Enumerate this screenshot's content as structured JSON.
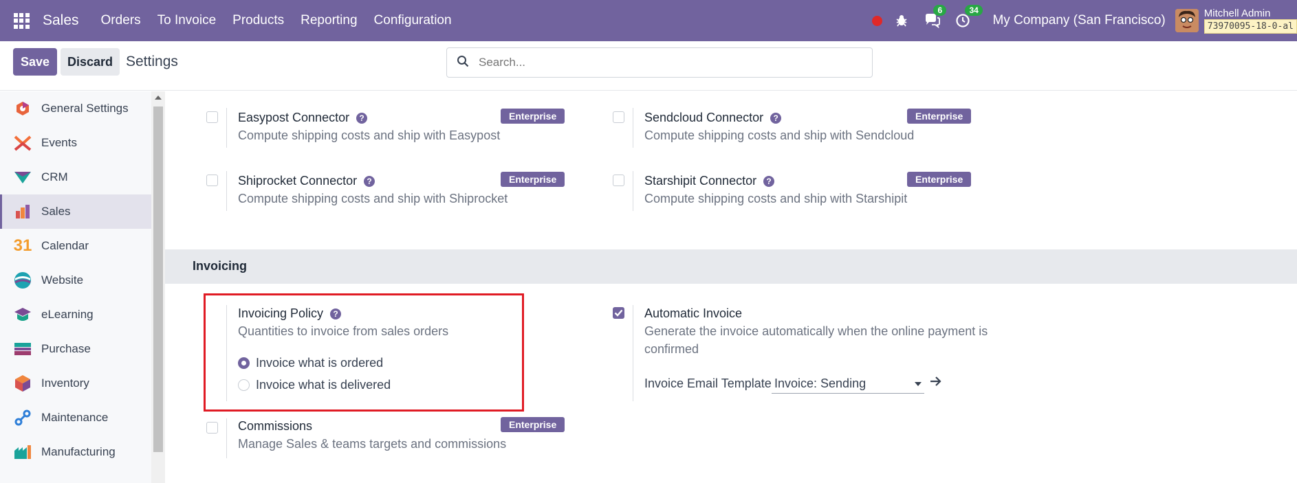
{
  "navbar": {
    "brand": "Sales",
    "menu": [
      "Orders",
      "To Invoice",
      "Products",
      "Reporting",
      "Configuration"
    ],
    "messages_count": "6",
    "activities_count": "34",
    "company": "My Company (San Francisco)",
    "user": "Mitchell Admin",
    "database": "73970095-18-0-al"
  },
  "control": {
    "save_label": "Save",
    "discard_label": "Discard",
    "title": "Settings",
    "search_placeholder": "Search..."
  },
  "sidebar": {
    "items": [
      {
        "label": "General Settings",
        "icon": "general-settings-icon",
        "color": "#e8643c"
      },
      {
        "label": "Events",
        "icon": "events-icon",
        "color": "#f36f3a"
      },
      {
        "label": "CRM",
        "icon": "crm-icon",
        "color": "#1aa39a"
      },
      {
        "label": "Sales",
        "icon": "sales-icon",
        "color": "#f0863e",
        "active": true
      },
      {
        "label": "Calendar",
        "icon": "calendar-icon",
        "color": "#f39c2d"
      },
      {
        "label": "Website",
        "icon": "website-icon",
        "color": "#1ea3b1"
      },
      {
        "label": "eLearning",
        "icon": "elearning-icon",
        "color": "#1aa38a"
      },
      {
        "label": "Purchase",
        "icon": "purchase-icon",
        "color": "#1aa39a"
      },
      {
        "label": "Inventory",
        "icon": "inventory-icon",
        "color": "#f0863e"
      },
      {
        "label": "Maintenance",
        "icon": "maintenance-icon",
        "color": "#2f7fd8"
      },
      {
        "label": "Manufacturing",
        "icon": "manufacturing-icon",
        "color": "#1aa39a"
      }
    ]
  },
  "enterprise_label": "Enterprise",
  "shipping": {
    "easypost": {
      "title": "Easypost Connector",
      "desc": "Compute shipping costs and ship with Easypost"
    },
    "sendcloud": {
      "title": "Sendcloud Connector",
      "desc": "Compute shipping costs and ship with Sendcloud"
    },
    "shiprocket": {
      "title": "Shiprocket Connector",
      "desc": "Compute shipping costs and ship with Shiprocket"
    },
    "starshipit": {
      "title": "Starshipit Connector",
      "desc": "Compute shipping costs and ship with Starshipit"
    }
  },
  "invoicing": {
    "section_title": "Invoicing",
    "policy": {
      "title": "Invoicing Policy",
      "desc": "Quantities to invoice from sales orders",
      "options": [
        "Invoice what is ordered",
        "Invoice what is delivered"
      ],
      "selected": "Invoice what is ordered"
    },
    "automatic": {
      "title": "Automatic Invoice",
      "desc": "Generate the invoice automatically when the online payment is confirmed",
      "checked": true,
      "template_label": "Invoice Email Template",
      "template_value": "Invoice: Sending"
    },
    "commissions": {
      "title": "Commissions",
      "desc": "Manage Sales & teams targets and commissions"
    }
  },
  "colors": {
    "brand": "#71639e",
    "highlight": "#e01b24"
  }
}
